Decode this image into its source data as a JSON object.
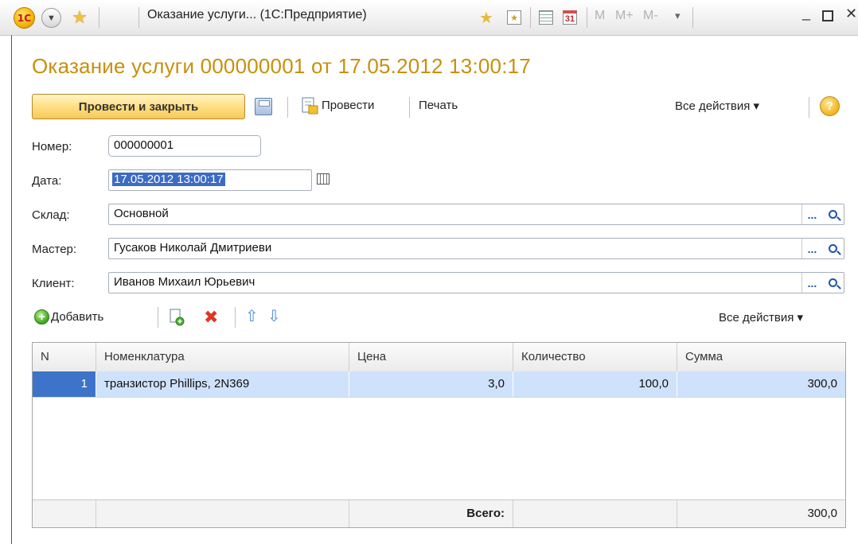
{
  "window": {
    "logo": "1С",
    "title": "Оказание услуги... (1С:Предприятие)",
    "memory_buttons": [
      "M",
      "M+",
      "M-"
    ],
    "icons": [
      "app-logo-icon",
      "menu-circle-icon",
      "star-icon",
      "favorite-star-icon",
      "bookmark-icon",
      "calculator-icon",
      "calendar-icon",
      "minimize-icon",
      "maximize-icon",
      "close-icon"
    ],
    "calendar_day": "31"
  },
  "document": {
    "heading": "Оказание услуги 000000001 от 17.05.2012 13:00:17"
  },
  "toolbar": {
    "post_and_close": "Провести и закрыть",
    "post": "Провести",
    "print": "Печать",
    "all_actions": "Все действия ▾",
    "help": "?"
  },
  "form": {
    "number_label": "Номер:",
    "number_value": "000000001",
    "date_label": "Дата:",
    "date_value": "17.05.2012 13:00:17",
    "warehouse_label": "Склад:",
    "warehouse_value": "Основной",
    "master_label": "Мастер:",
    "master_value": "Гусаков Николай Дмитриеви",
    "client_label": "Клиент:",
    "client_value": "Иванов Михаил Юрьевич",
    "pick_button": "..."
  },
  "table_toolbar": {
    "add": "Добавить",
    "all_actions": "Все действия ▾"
  },
  "table": {
    "headers": [
      "N",
      "Номенклатура",
      "Цена",
      "Количество",
      "Сумма"
    ],
    "rows": [
      {
        "n": "1",
        "item": "транзистор Phillips, 2N369",
        "price": "3,0",
        "qty": "100,0",
        "sum": "300,0"
      }
    ],
    "footer": {
      "total_label": "Всего:",
      "total_sum": "300,0"
    }
  },
  "colors": {
    "heading": "#c8900c",
    "primary_button": "#f6c957",
    "selected_row": "#cfe2fb",
    "selected_cell": "#3d73c8"
  }
}
